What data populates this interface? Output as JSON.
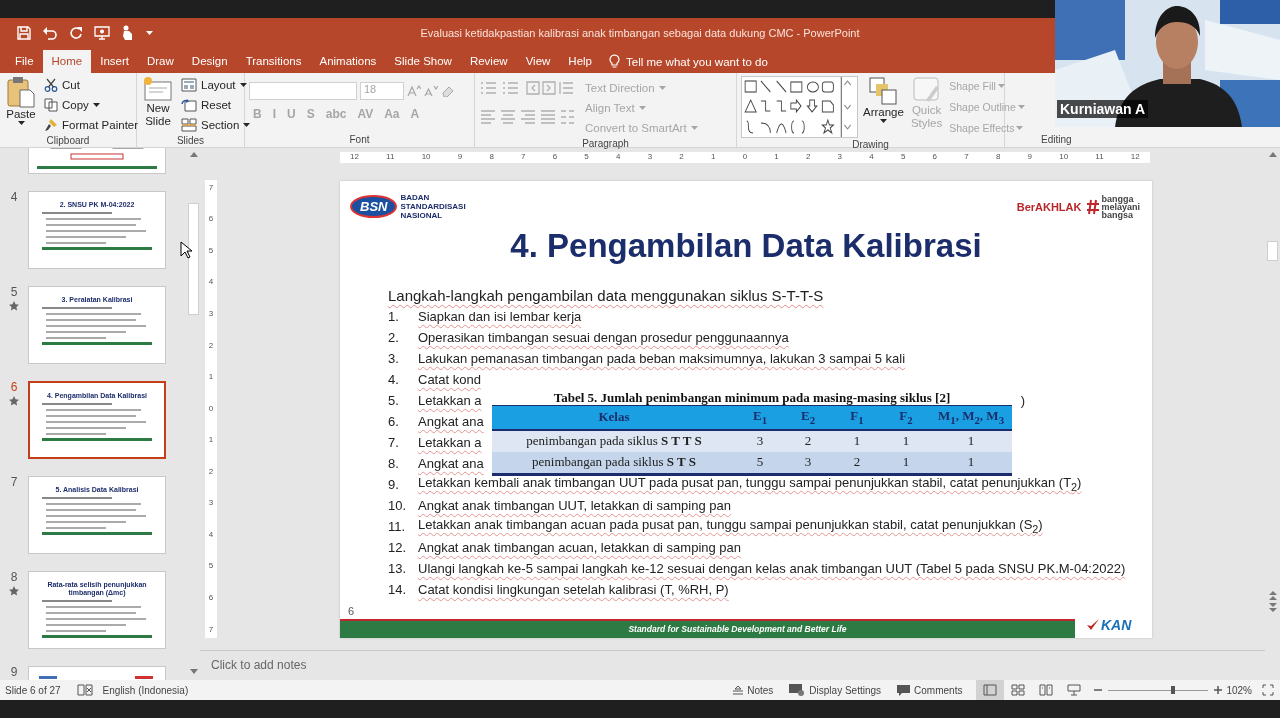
{
  "window": {
    "title": "Evaluasi ketidakpastian kalibrasi anak timbangan sebagai data dukung CMC  -  PowerPoint"
  },
  "quick_access": [
    {
      "kind": "save"
    },
    {
      "kind": "undo"
    },
    {
      "kind": "redo"
    },
    {
      "kind": "present"
    },
    {
      "kind": "touch"
    }
  ],
  "tabs": [
    {
      "label": "File",
      "selected": false
    },
    {
      "label": "Home",
      "selected": true
    },
    {
      "label": "Insert",
      "selected": false
    },
    {
      "label": "Draw",
      "selected": false
    },
    {
      "label": "Design",
      "selected": false
    },
    {
      "label": "Transitions",
      "selected": false
    },
    {
      "label": "Animations",
      "selected": false
    },
    {
      "label": "Slide Show",
      "selected": false
    },
    {
      "label": "Review",
      "selected": false
    },
    {
      "label": "View",
      "selected": false
    },
    {
      "label": "Help",
      "selected": false
    }
  ],
  "tell_me": "Tell me what you want to do",
  "ribbon": {
    "clipboard": {
      "label": "Clipboard",
      "paste": "Paste",
      "commands": [
        {
          "kind": "cut",
          "label": "Cut"
        },
        {
          "kind": "copy",
          "label": "Copy"
        },
        {
          "kind": "painter",
          "label": "Format Painter"
        }
      ]
    },
    "slides": {
      "label": "Slides",
      "new_slide": "New Slide",
      "commands": [
        {
          "kind": "layout",
          "label": "Layout"
        },
        {
          "kind": "reset",
          "label": "Reset"
        },
        {
          "kind": "section",
          "label": "Section"
        }
      ]
    },
    "font": {
      "label": "Font",
      "disabled": true,
      "size": "18",
      "formats": [
        "B",
        "I",
        "U",
        "S",
        "abc",
        "AV",
        "Aa",
        "A"
      ]
    },
    "paragraph": {
      "label": "Paragraph",
      "disabled": true,
      "commands": [
        "Text Direction",
        "Align Text",
        "Convert to SmartArt"
      ]
    },
    "drawing": {
      "label": "Drawing",
      "arrange": "Arrange",
      "quick_styles": {
        "label": "Quick Styles",
        "disabled": true
      },
      "commands": [
        {
          "label": "Shape Fill",
          "disabled": true
        },
        {
          "label": "Shape Outline",
          "disabled": true
        },
        {
          "label": "Shape Effects",
          "disabled": true
        }
      ]
    },
    "editing": {
      "label": "Editing"
    }
  },
  "rulers": {
    "horizontal": [
      "12",
      "11",
      "10",
      "9",
      "8",
      "7",
      "6",
      "5",
      "4",
      "3",
      "2",
      "1",
      "0",
      "1",
      "2",
      "3",
      "4",
      "5",
      "6",
      "7",
      "8",
      "9",
      "10",
      "11",
      "12"
    ],
    "vertical": [
      "7",
      "6",
      "5",
      "4",
      "3",
      "2",
      "1",
      "0",
      "1",
      "2",
      "3",
      "4",
      "5",
      "6",
      "7"
    ]
  },
  "thumbnails": [
    {
      "starred": false,
      "selected": false
    },
    {
      "number": "4",
      "title": "2. SNSU PK M-04:2022",
      "starred": false,
      "selected": false
    },
    {
      "number": "5",
      "title": "3. Peralatan Kalibrasi",
      "starred": true,
      "selected": false
    },
    {
      "number": "6",
      "title": "4. Pengambilan Data Kalibrasi",
      "starred": true,
      "selected": true
    },
    {
      "number": "7",
      "title": "5. Analisis Data Kalibrasi",
      "starred": false,
      "selected": false
    },
    {
      "number": "8",
      "title": "Rata-rata selisih penunjukkan timbangan (Δmc)",
      "starred": true,
      "selected": false
    },
    {
      "number": "9",
      "starred": false,
      "selected": false
    }
  ],
  "slide": {
    "logos": {
      "bsn_mark": "BSN",
      "bsn_name": "BADAN STANDARDISASI NASIONAL",
      "berakhlak": "BerAKHLAK",
      "slogan": [
        "bangga",
        "melayani",
        "bangsa"
      ],
      "kan": "KAN"
    },
    "title": "4. Pengambilan Data Kalibrasi",
    "intro": "Langkah-langkah pengambilan data menggunakan siklus S-T-T-S",
    "steps": [
      {
        "number": "1.",
        "text": "Siapkan dan isi lembar kerja"
      },
      {
        "number": "2.",
        "text": "Operasikan timbangan sesuai dengan prosedur penggunaannya"
      },
      {
        "number": "3.",
        "text": "Lakukan pemanasan timbangan pada beban maksimumnya, lakukan 3 sampai 5 kali"
      },
      {
        "number": "4.",
        "text": "Catat kond"
      },
      {
        "number": "5.",
        "text": "Letakkan a",
        "tail": ")"
      },
      {
        "number": "6.",
        "text": "Angkat ana"
      },
      {
        "number": "7.",
        "text": "Letakkan a"
      },
      {
        "number": "8.",
        "text": "Angkat ana"
      },
      {
        "number": "9.",
        "text": "Letakkan kembali anak timbangan UUT pada pusat pan, tunggu sampai penunjukkan stabil, catat penunjukkan (T$_{2}$)"
      },
      {
        "number": "10.",
        "text": "Angkat anak timbangan UUT, letakkan di samping pan"
      },
      {
        "number": "11.",
        "text": "Letakkan anak timbangan acuan pada pusat pan, tunggu sampai penunjukkan stabil, catat penunjukkan (S$_{2}$)"
      },
      {
        "number": "12.",
        "text": "Angkat anak timbangan acuan, letakkan di samping pan"
      },
      {
        "number": "13.",
        "text": "Ulangi langkah ke-5 sampai langkah ke-12 sesuai dengan kelas anak timbangan UUT (Tabel 5 pada SNSU PK.M-04:2022)"
      },
      {
        "number": "14.",
        "text": "Catat kondisi lingkungan setelah kalibrasi (T, %RH, P)"
      }
    ],
    "table": {
      "caption": "Tabel 5. Jumlah penimbangan minimum pada masing-masing siklus [2]",
      "columns": [
        "Kelas",
        "E$_{1}$",
        "E$_{2}$",
        "F$_{1}$",
        "F$_{2}$",
        "M$_{1}$, M$_{2}$, M$_{3}$"
      ],
      "rows": [
        [
          "penimbangan pada siklus **S T T S**",
          "3",
          "2",
          "1",
          "1",
          "1"
        ],
        [
          "penimbangan pada siklus **S T S**",
          "5",
          "3",
          "2",
          "1",
          "1"
        ]
      ]
    },
    "page_number": "6",
    "footer": "Standard for Sustainable Development and Better Life"
  },
  "notes": {
    "placeholder": "Click to add notes"
  },
  "status_bar": {
    "slide": "Slide 6 of 27",
    "language": "English (Indonesia)",
    "notes": "Notes",
    "display_settings": "Display Settings",
    "comments": "Comments",
    "views": [
      {
        "kind": "normal",
        "selected": true
      },
      {
        "kind": "sorter",
        "selected": false
      },
      {
        "kind": "reading",
        "selected": false
      },
      {
        "kind": "slideshow",
        "selected": false
      }
    ],
    "zoom": {
      "level": 0.65,
      "reading": "102%"
    }
  },
  "video": {
    "name": "Kurniawan A"
  }
}
